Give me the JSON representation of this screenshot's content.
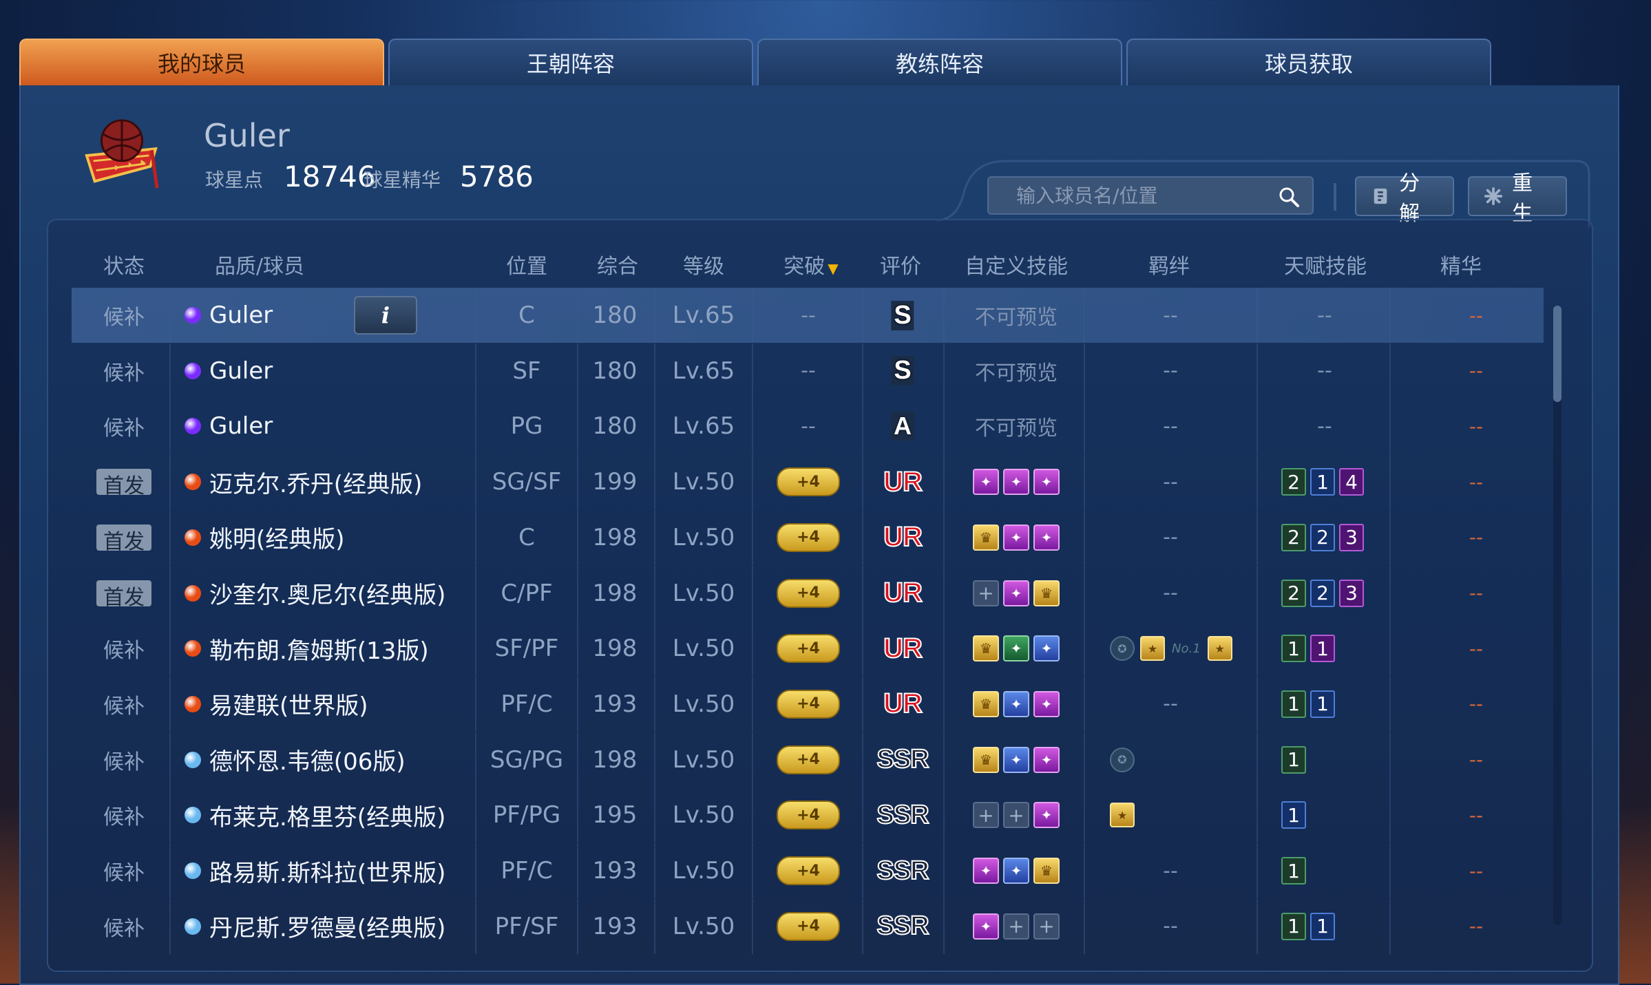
{
  "tabs": [
    {
      "label": "我的球员",
      "active": true
    },
    {
      "label": "王朝阵容",
      "active": false
    },
    {
      "label": "教练阵容",
      "active": false
    },
    {
      "label": "球员获取",
      "active": false
    }
  ],
  "header": {
    "player_name": "Guler",
    "star_points_label": "球星点",
    "star_points_value": "18746",
    "essence_label": "球星精华",
    "essence_value": "5786"
  },
  "toolbar": {
    "search_placeholder": "输入球员名/位置",
    "decompose_label": "分解",
    "rebirth_label": "重生"
  },
  "columns": [
    "状态",
    "品质/球员",
    "位置",
    "综合",
    "等级",
    "突破",
    "评价",
    "自定义技能",
    "羁绊",
    "天赋技能",
    "精华"
  ],
  "colors": {
    "accent_tab": "#e27a32",
    "quality_purple": "#7a2cff",
    "quality_red": "#e84c14",
    "quality_blue": "#6ab8f0"
  },
  "rows": [
    {
      "status": "候补",
      "starter": false,
      "quality": "purple",
      "name": "Guler",
      "pos": "C",
      "ovr": "180",
      "level": "Lv.65",
      "break": "--",
      "grade": "S",
      "skills_text": "不可预览",
      "bond_text": "--",
      "talent_text": "--",
      "essence": "--"
    },
    {
      "status": "候补",
      "starter": false,
      "quality": "purple",
      "name": "Guler",
      "pos": "SF",
      "ovr": "180",
      "level": "Lv.65",
      "break": "--",
      "grade": "S",
      "skills_text": "不可预览",
      "bond_text": "--",
      "talent_text": "--",
      "essence": "--"
    },
    {
      "status": "候补",
      "starter": false,
      "quality": "purple",
      "name": "Guler",
      "pos": "PG",
      "ovr": "180",
      "level": "Lv.65",
      "break": "--",
      "grade": "A",
      "skills_text": "不可预览",
      "bond_text": "--",
      "talent_text": "--",
      "essence": "--"
    },
    {
      "status": "首发",
      "starter": true,
      "quality": "red",
      "name": "迈克尔.乔丹(经典版)",
      "pos": "SG/SF",
      "ovr": "199",
      "level": "Lv.50",
      "break": "+4",
      "grade": "UR",
      "skills": [
        "purple",
        "purple",
        "purple"
      ],
      "bond_text": "--",
      "talents": [
        {
          "v": "2",
          "c": "green"
        },
        {
          "v": "1",
          "c": "blue"
        },
        {
          "v": "4",
          "c": "purple"
        }
      ],
      "essence": "--"
    },
    {
      "status": "首发",
      "starter": true,
      "quality": "red",
      "name": "姚明(经典版)",
      "pos": "C",
      "ovr": "198",
      "level": "Lv.50",
      "break": "+4",
      "grade": "UR",
      "skills": [
        "gold",
        "purple",
        "purple"
      ],
      "bond_text": "--",
      "talents": [
        {
          "v": "2",
          "c": "green"
        },
        {
          "v": "2",
          "c": "blue"
        },
        {
          "v": "3",
          "c": "purple"
        }
      ],
      "essence": "--"
    },
    {
      "status": "首发",
      "starter": true,
      "quality": "red",
      "name": "沙奎尔.奥尼尔(经典版)",
      "pos": "C/PF",
      "ovr": "198",
      "level": "Lv.50",
      "break": "+4",
      "grade": "UR",
      "skills": [
        "empty",
        "purple",
        "gold"
      ],
      "bond_text": "--",
      "talents": [
        {
          "v": "2",
          "c": "green"
        },
        {
          "v": "2",
          "c": "blue"
        },
        {
          "v": "3",
          "c": "purple"
        }
      ],
      "essence": "--"
    },
    {
      "status": "候补",
      "starter": false,
      "quality": "red",
      "name": "勒布朗.詹姆斯(13版)",
      "pos": "SF/PF",
      "ovr": "198",
      "level": "Lv.50",
      "break": "+4",
      "grade": "UR",
      "skills": [
        "gold",
        "green",
        "blue"
      ],
      "bonds": [
        "dim",
        "gold",
        "no1",
        "gold"
      ],
      "bond_no1": "No.1",
      "talents": [
        {
          "v": "1",
          "c": "green"
        },
        {
          "v": "1",
          "c": "purple"
        }
      ],
      "essence": "--"
    },
    {
      "status": "候补",
      "starter": false,
      "quality": "red",
      "name": "易建联(世界版)",
      "pos": "PF/C",
      "ovr": "193",
      "level": "Lv.50",
      "break": "+4",
      "grade": "UR",
      "skills": [
        "gold",
        "blue",
        "purple"
      ],
      "bond_text": "--",
      "talents": [
        {
          "v": "1",
          "c": "green"
        },
        {
          "v": "1",
          "c": "blue"
        }
      ],
      "essence": "--"
    },
    {
      "status": "候补",
      "starter": false,
      "quality": "blue",
      "name": "德怀恩.韦德(06版)",
      "pos": "SG/PG",
      "ovr": "198",
      "level": "Lv.50",
      "break": "+4",
      "grade": "SSR",
      "skills": [
        "gold",
        "blue",
        "purple"
      ],
      "bonds": [
        "dim"
      ],
      "talents": [
        {
          "v": "1",
          "c": "green"
        }
      ],
      "essence": "--"
    },
    {
      "status": "候补",
      "starter": false,
      "quality": "blue",
      "name": "布莱克.格里芬(经典版)",
      "pos": "PF/PG",
      "ovr": "195",
      "level": "Lv.50",
      "break": "+4",
      "grade": "SSR",
      "skills": [
        "empty",
        "empty",
        "purple"
      ],
      "bonds": [
        "gold"
      ],
      "talents": [
        {
          "v": "1",
          "c": "blue"
        }
      ],
      "essence": "--"
    },
    {
      "status": "候补",
      "starter": false,
      "quality": "blue",
      "name": "路易斯.斯科拉(世界版)",
      "pos": "PF/C",
      "ovr": "193",
      "level": "Lv.50",
      "break": "+4",
      "grade": "SSR",
      "skills": [
        "purple",
        "blue",
        "gold"
      ],
      "bond_text": "--",
      "talents": [
        {
          "v": "1",
          "c": "green"
        }
      ],
      "essence": "--"
    },
    {
      "status": "候补",
      "starter": false,
      "quality": "blue",
      "name": "丹尼斯.罗德曼(经典版)",
      "pos": "PF/SF",
      "ovr": "193",
      "level": "Lv.50",
      "break": "+4",
      "grade": "SSR",
      "skills": [
        "purple",
        "empty",
        "empty"
      ],
      "bond_text": "--",
      "talents": [
        {
          "v": "1",
          "c": "green"
        },
        {
          "v": "1",
          "c": "blue"
        }
      ],
      "essence": "--"
    }
  ]
}
